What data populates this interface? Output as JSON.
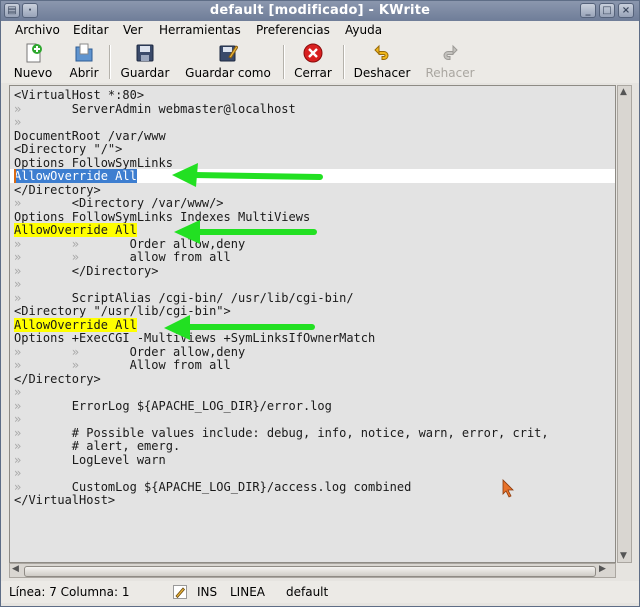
{
  "window": {
    "title": "default [modificado] - KWrite"
  },
  "menubar": {
    "items": [
      "Archivo",
      "Editar",
      "Ver",
      "Herramientas",
      "Preferencias",
      "Ayuda"
    ]
  },
  "toolbar": {
    "new_label": "Nuevo",
    "open_label": "Abrir",
    "save_label": "Guardar",
    "save_as_label": "Guardar como",
    "close_label": "Cerrar",
    "undo_label": "Deshacer",
    "redo_label": "Rehacer"
  },
  "editor": {
    "lines": [
      "<VirtualHost *:80>",
      "        ServerAdmin webmaster@localhost",
      "",
      "DocumentRoot /var/www",
      "<Directory \"/\">",
      "Options FollowSymLinks",
      "AllowOverride All",
      "</Directory>",
      "        <Directory /var/www/>",
      "Options FollowSymLinks Indexes MultiViews",
      "AllowOverride All",
      "                Order allow,deny",
      "                allow from all",
      "        </Directory>",
      "",
      "        ScriptAlias /cgi-bin/ /usr/lib/cgi-bin/",
      "<Directory \"/usr/lib/cgi-bin\">",
      "AllowOverride All",
      "Options +ExecCGI -MultiViews +SymLinksIfOwnerMatch",
      "                Order allow,deny",
      "                Allow from all",
      "</Directory>",
      "",
      "        ErrorLog ${APACHE_LOG_DIR}/error.log",
      "",
      "        # Possible values include: debug, info, notice, warn, error, crit,",
      "        # alert, emerg.",
      "        LogLevel warn",
      "",
      "        CustomLog ${APACHE_LOG_DIR}/access.log combined",
      "</VirtualHost>"
    ],
    "tab_marker": "»"
  },
  "statusbar": {
    "position": "Línea: 7 Columna: 1",
    "insert_mode": "INS",
    "selection_mode": "LINEA",
    "syntax": "default"
  },
  "colors": {
    "highlight": "#ffff00",
    "selection": "#3d7ed0",
    "arrow": "#22e022"
  }
}
